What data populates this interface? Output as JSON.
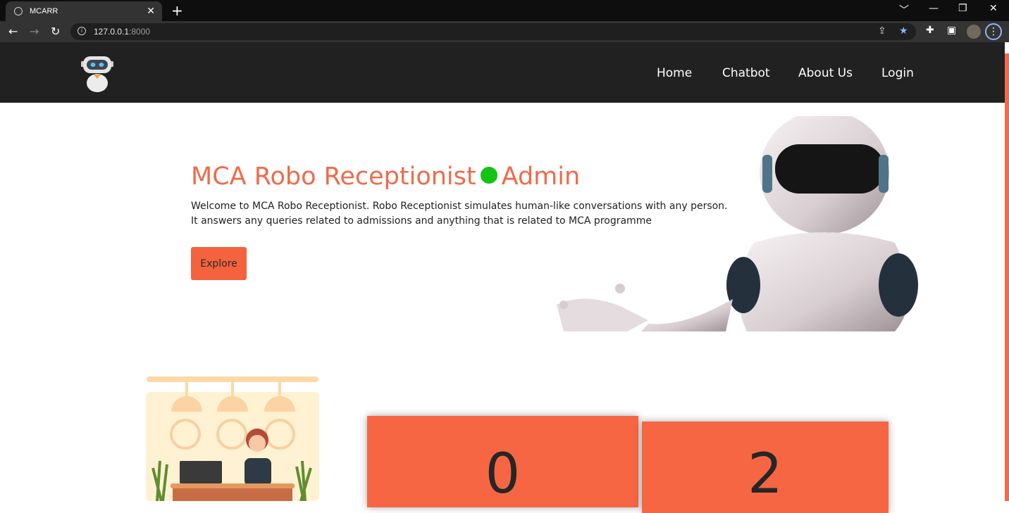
{
  "browser": {
    "tab_title": "MCARR",
    "tab_close": "✕",
    "new_tab": "+",
    "url_host": "127.0.0.1",
    "url_port": ":8000",
    "window_controls": [
      "﹀",
      "—",
      "❐",
      "✕"
    ],
    "icons": [
      "globe-icon",
      "back-icon",
      "forward-icon",
      "reload-icon",
      "info-icon",
      "share-icon",
      "star-icon",
      "extensions-icon",
      "sidepanel-icon",
      "profile-avatar",
      "menu-icon"
    ]
  },
  "nav": {
    "logo_icon": "robot-logo-icon",
    "links": [
      "Home",
      "Chatbot",
      "About Us",
      "Login"
    ]
  },
  "hero": {
    "title_left": "MCA Robo Receptionist",
    "title_right": "Admin",
    "status_color": "#13c313",
    "line1": "Welcome to MCA Robo Receptionist. Robo Receptionist simulates human-like conversations with any person.",
    "line2": "It answers any queries related to admissions and anything that is related to MCA programme",
    "button": "Explore",
    "accent_color": "#ef6b4b"
  },
  "stats": [
    "0",
    "2"
  ]
}
